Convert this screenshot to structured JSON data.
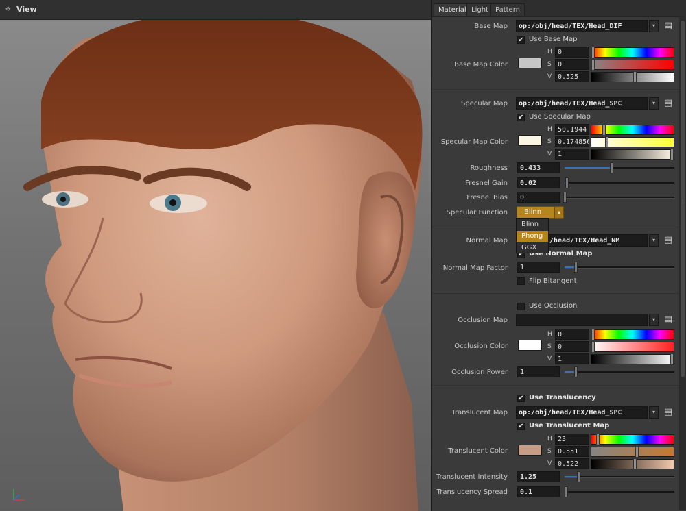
{
  "viewport": {
    "title": "View",
    "icon": "viewport-menu-icon"
  },
  "tabs": [
    {
      "label": "Material",
      "active": true
    },
    {
      "label": "Light",
      "active": false
    },
    {
      "label": "Pattern",
      "active": false
    }
  ],
  "base": {
    "map_label": "Base Map",
    "map_path": "op:/obj/head/TEX/Head_DIF",
    "use_map_label": "Use Base Map",
    "use_map_checked": true,
    "color_label": "Base Map Color",
    "color_swatch": "#c6c6c6",
    "h": "0",
    "s": "0",
    "v": "0.525",
    "h_level": 0.0,
    "s_level": 0.0,
    "v_level": 0.525
  },
  "specular": {
    "map_label": "Specular Map",
    "map_path": "op:/obj/head/TEX/Head_SPC",
    "use_map_label": "Use Specular Map",
    "use_map_checked": true,
    "color_label": "Specular Map Color",
    "color_swatch": "#fbf6e3",
    "h": "50.1944",
    "s": "0.174856",
    "v": "1",
    "h_level": 0.14,
    "s_level": 0.175,
    "v_level": 1.0,
    "roughness_label": "Roughness",
    "roughness": "0.433",
    "roughness_level": 0.433,
    "fresnel_gain_label": "Fresnel Gain",
    "fresnel_gain": "0.02",
    "fresnel_gain_level": 0.02,
    "fresnel_bias_label": "Fresnel Bias",
    "fresnel_bias": "0",
    "fresnel_bias_level": 0.0,
    "function_label": "Specular Function",
    "function_value": "Blinn",
    "function_options": [
      "Blinn",
      "Phong",
      "GGX"
    ],
    "function_highlighted": "Phong"
  },
  "normal": {
    "map_label": "Normal Map",
    "map_path_visible": "/head/TEX/Head_NM",
    "use_map_label": "Use Normal Map",
    "use_map_checked": true,
    "factor_label": "Normal Map Factor",
    "factor": "1",
    "factor_level": 0.1,
    "flip_label": "Flip Bitangent",
    "flip_checked": false
  },
  "occlusion": {
    "use_label": "Use Occlusion",
    "use_checked": false,
    "map_label": "Occlusion Map",
    "map_path": "",
    "color_label": "Occlusion Color",
    "color_swatch": "#ffffff",
    "h": "0",
    "s": "0",
    "v": "1",
    "h_level": 0.0,
    "s_level": 0.0,
    "v_level": 1.0,
    "power_label": "Occlusion Power",
    "power": "1",
    "power_level": 0.1
  },
  "translucency": {
    "use_label": "Use Translucency",
    "use_checked": true,
    "map_label": "Translucent Map",
    "map_path": "op:/obj/head/TEX/Head_SPC",
    "use_map_label": "Use Translucent Map",
    "use_map_checked": true,
    "color_label": "Translucent Color",
    "color_swatch": "#c79d85",
    "h": "23",
    "s": "0.551",
    "v": "0.522",
    "h_level": 0.064,
    "s_level": 0.551,
    "v_level": 0.522,
    "intensity_label": "Translucent Intensity",
    "intensity": "1.25",
    "intensity_level": 0.125,
    "spread_label": "Translucency Spread",
    "spread": "0.1",
    "spread_level": 0.01
  },
  "hsv_letters": {
    "h": "H",
    "s": "S",
    "v": "V"
  },
  "colors": {
    "accent": "#b5851e",
    "slider_fill": "#3b6fb6",
    "panel_bg": "#3a3a3a"
  }
}
